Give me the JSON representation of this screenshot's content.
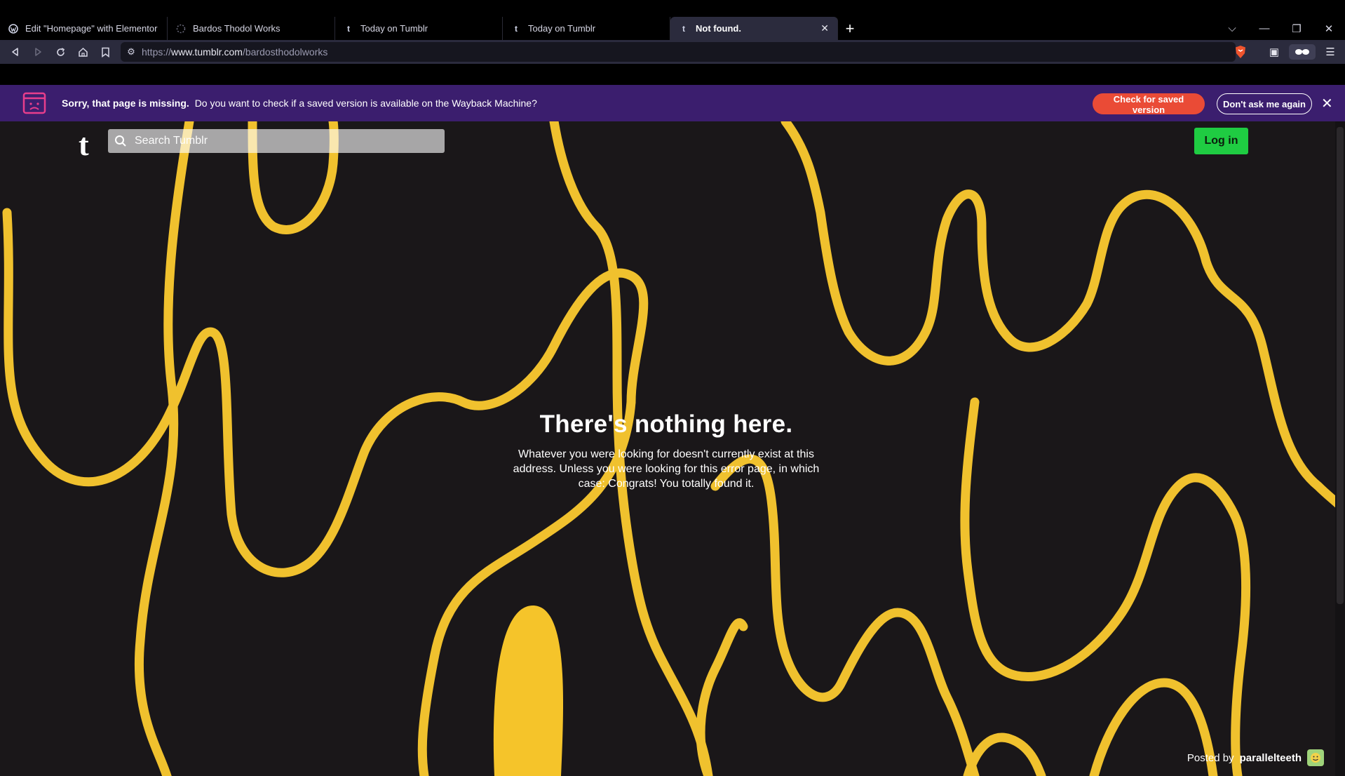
{
  "browser": {
    "tabs": [
      {
        "title": "Edit \"Homepage\" with Elementor",
        "icon": "wordpress-icon",
        "active": false
      },
      {
        "title": "Bardos Thodol Works",
        "icon": "loading-icon",
        "active": false
      },
      {
        "title": "Today on Tumblr",
        "icon": "tumblr-icon",
        "active": false
      },
      {
        "title": "Today on Tumblr",
        "icon": "tumblr-icon",
        "active": false
      },
      {
        "title": "Not found.",
        "icon": "tumblr-icon",
        "active": true
      }
    ],
    "url_scheme": "https://",
    "url_host": "www.tumblr.com",
    "url_path": "/bardosthodolworks"
  },
  "banner": {
    "bold_text": "Sorry, that page is missing.",
    "text": "Do you want to check if a saved version is available on the Wayback Machine?",
    "check_button": "Check for saved version",
    "dont_ask_button": "Don't ask me again"
  },
  "page": {
    "logo": "t",
    "search_placeholder": "Search Tumblr",
    "login_button": "Log in",
    "heading": "There's nothing here.",
    "message": "Whatever you were looking for doesn't currently exist at this address. Unless you were looking for this error page, in which case: Congrats! You totally found it.",
    "posted_by_label": "Posted by",
    "posted_by_user": "parallelteeth"
  },
  "colors": {
    "banner_bg": "#3b1e6e",
    "check_button": "#ea4b36",
    "login_button": "#1fcc42",
    "page_bg": "#1a1719",
    "squiggle": "#f0c12e"
  }
}
